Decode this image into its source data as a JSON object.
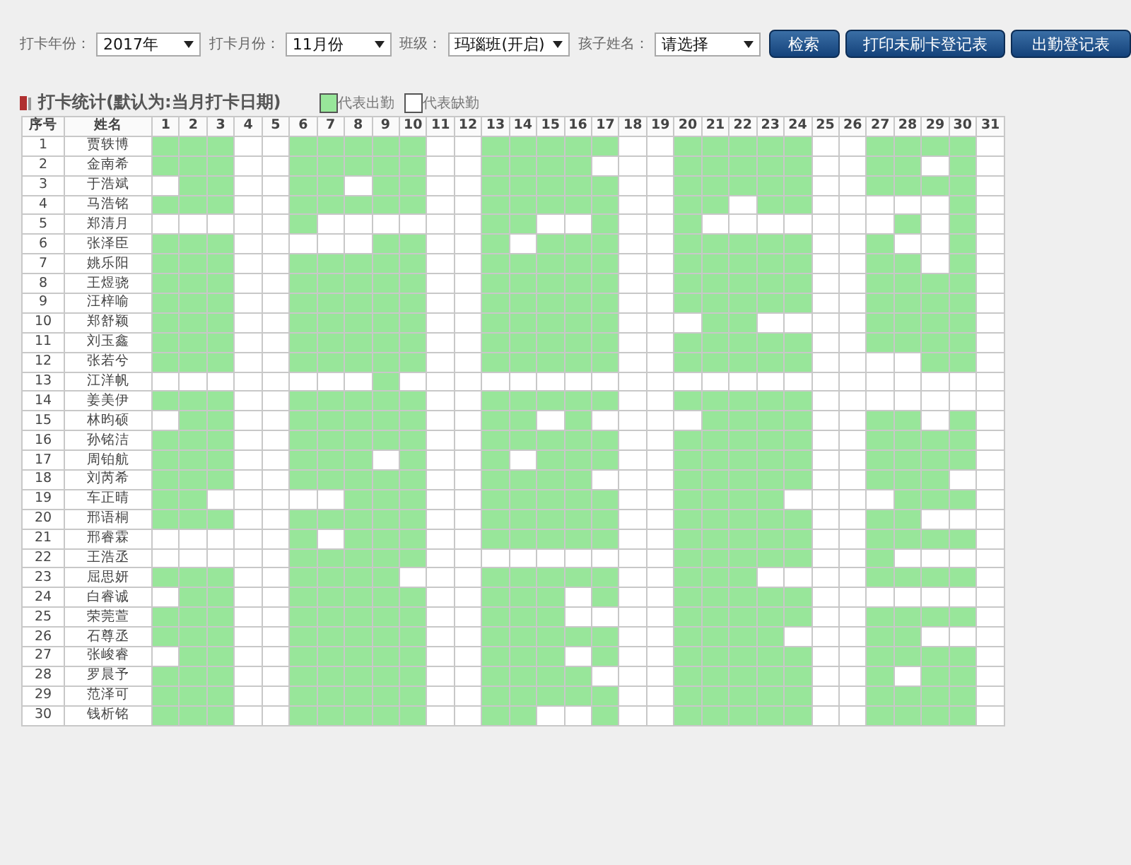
{
  "filters": [
    {
      "label": "打卡年份：",
      "value": "2017年"
    },
    {
      "label": "打卡月份：",
      "value": "11月份"
    },
    {
      "label": "班级：",
      "value": "玛瑙班(开启)"
    },
    {
      "label": "孩子姓名：",
      "value": "请选择"
    }
  ],
  "buttons": [
    "检索",
    "打印未刷卡登记表",
    "出勤登记表"
  ],
  "section_title": "打卡统计(默认为:当月打卡日期)",
  "legend": [
    {
      "label": "代表出勤",
      "color": "#98e69a"
    },
    {
      "label": "代表缺勤",
      "color": "#ffffff"
    }
  ],
  "columns": [
    "序号",
    "姓名",
    "1",
    "2",
    "3",
    "4",
    "5",
    "6",
    "7",
    "8",
    "9",
    "10",
    "11",
    "12",
    "13",
    "14",
    "15",
    "16",
    "17",
    "18",
    "19",
    "20",
    "21",
    "22",
    "23",
    "24",
    "25",
    "26",
    "27",
    "28",
    "29",
    "30",
    "31"
  ],
  "rows": [
    {
      "no": "1",
      "name": "贾轶博",
      "present": [
        true,
        true,
        true,
        false,
        false,
        true,
        true,
        true,
        true,
        true,
        false,
        false,
        true,
        true,
        true,
        true,
        true,
        false,
        false,
        true,
        true,
        true,
        true,
        true,
        false,
        false,
        true,
        true,
        true,
        true,
        false
      ]
    },
    {
      "no": "2",
      "name": "金南希",
      "present": [
        true,
        true,
        true,
        false,
        false,
        true,
        true,
        true,
        true,
        true,
        false,
        false,
        true,
        true,
        true,
        true,
        false,
        false,
        false,
        true,
        true,
        true,
        true,
        true,
        false,
        false,
        true,
        true,
        false,
        true,
        false
      ]
    },
    {
      "no": "3",
      "name": "于浩斌",
      "present": [
        false,
        true,
        true,
        false,
        false,
        true,
        true,
        false,
        true,
        true,
        false,
        false,
        true,
        true,
        true,
        true,
        true,
        false,
        false,
        true,
        true,
        true,
        true,
        true,
        false,
        false,
        true,
        true,
        true,
        true,
        false
      ]
    },
    {
      "no": "4",
      "name": "马浩铭",
      "present": [
        true,
        true,
        true,
        false,
        false,
        true,
        true,
        true,
        true,
        true,
        false,
        false,
        true,
        true,
        true,
        true,
        true,
        false,
        false,
        true,
        true,
        false,
        true,
        true,
        false,
        false,
        false,
        false,
        false,
        true,
        false
      ]
    },
    {
      "no": "5",
      "name": "郑清月",
      "present": [
        false,
        false,
        false,
        false,
        false,
        true,
        false,
        false,
        false,
        false,
        false,
        false,
        true,
        true,
        false,
        false,
        true,
        false,
        false,
        true,
        false,
        false,
        false,
        false,
        false,
        false,
        false,
        true,
        false,
        true,
        false
      ]
    },
    {
      "no": "6",
      "name": "张泽臣",
      "present": [
        true,
        true,
        true,
        false,
        false,
        false,
        false,
        false,
        true,
        true,
        false,
        false,
        true,
        false,
        true,
        true,
        true,
        false,
        false,
        true,
        true,
        true,
        true,
        true,
        false,
        false,
        true,
        false,
        false,
        true,
        false
      ]
    },
    {
      "no": "7",
      "name": "姚乐阳",
      "present": [
        true,
        true,
        true,
        false,
        false,
        true,
        true,
        true,
        true,
        true,
        false,
        false,
        true,
        true,
        true,
        true,
        true,
        false,
        false,
        true,
        true,
        true,
        true,
        true,
        false,
        false,
        true,
        true,
        false,
        true,
        false
      ]
    },
    {
      "no": "8",
      "name": "王煜骁",
      "present": [
        true,
        true,
        true,
        false,
        false,
        true,
        true,
        true,
        true,
        true,
        false,
        false,
        true,
        true,
        true,
        true,
        true,
        false,
        false,
        true,
        true,
        true,
        true,
        true,
        false,
        false,
        true,
        true,
        true,
        true,
        false
      ]
    },
    {
      "no": "9",
      "name": "汪梓喻",
      "present": [
        true,
        true,
        true,
        false,
        false,
        true,
        true,
        true,
        true,
        true,
        false,
        false,
        true,
        true,
        true,
        true,
        true,
        false,
        false,
        true,
        true,
        true,
        true,
        true,
        false,
        false,
        true,
        true,
        true,
        true,
        false
      ]
    },
    {
      "no": "10",
      "name": "郑舒颖",
      "present": [
        true,
        true,
        true,
        false,
        false,
        true,
        true,
        true,
        true,
        true,
        false,
        false,
        true,
        true,
        true,
        true,
        true,
        false,
        false,
        false,
        true,
        true,
        false,
        false,
        false,
        false,
        true,
        true,
        true,
        true,
        false
      ]
    },
    {
      "no": "11",
      "name": "刘玉鑫",
      "present": [
        true,
        true,
        true,
        false,
        false,
        true,
        true,
        true,
        true,
        true,
        false,
        false,
        true,
        true,
        true,
        true,
        true,
        false,
        false,
        true,
        true,
        true,
        true,
        true,
        false,
        false,
        true,
        true,
        true,
        true,
        false
      ]
    },
    {
      "no": "12",
      "name": "张若兮",
      "present": [
        true,
        true,
        true,
        false,
        false,
        true,
        true,
        true,
        true,
        true,
        false,
        false,
        true,
        true,
        true,
        true,
        true,
        false,
        false,
        true,
        true,
        true,
        true,
        true,
        false,
        false,
        false,
        false,
        true,
        true,
        false
      ]
    },
    {
      "no": "13",
      "name": "江洋帆",
      "present": [
        false,
        false,
        false,
        false,
        false,
        false,
        false,
        false,
        true,
        false,
        false,
        false,
        false,
        false,
        false,
        false,
        false,
        false,
        false,
        false,
        false,
        false,
        false,
        false,
        false,
        false,
        false,
        false,
        false,
        false,
        false
      ]
    },
    {
      "no": "14",
      "name": "姜美伊",
      "present": [
        true,
        true,
        true,
        false,
        false,
        true,
        true,
        true,
        true,
        true,
        false,
        false,
        true,
        true,
        true,
        true,
        true,
        false,
        false,
        true,
        true,
        true,
        true,
        true,
        false,
        false,
        false,
        false,
        false,
        false,
        false
      ]
    },
    {
      "no": "15",
      "name": "林昀硕",
      "present": [
        false,
        true,
        true,
        false,
        false,
        true,
        true,
        true,
        true,
        true,
        false,
        false,
        true,
        true,
        false,
        true,
        false,
        false,
        false,
        false,
        true,
        true,
        true,
        true,
        false,
        false,
        true,
        true,
        false,
        true,
        false
      ]
    },
    {
      "no": "16",
      "name": "孙铭洁",
      "present": [
        true,
        true,
        true,
        false,
        false,
        true,
        true,
        true,
        true,
        true,
        false,
        false,
        true,
        true,
        true,
        true,
        true,
        false,
        false,
        true,
        true,
        true,
        true,
        true,
        false,
        false,
        true,
        true,
        true,
        true,
        false
      ]
    },
    {
      "no": "17",
      "name": "周铂航",
      "present": [
        true,
        true,
        true,
        false,
        false,
        true,
        true,
        true,
        false,
        true,
        false,
        false,
        true,
        false,
        true,
        true,
        true,
        false,
        false,
        true,
        true,
        true,
        true,
        true,
        false,
        false,
        true,
        true,
        true,
        true,
        false
      ]
    },
    {
      "no": "18",
      "name": "刘芮希",
      "present": [
        true,
        true,
        true,
        false,
        false,
        true,
        true,
        true,
        true,
        true,
        false,
        false,
        true,
        true,
        true,
        true,
        false,
        false,
        false,
        true,
        true,
        true,
        true,
        true,
        false,
        false,
        true,
        true,
        true,
        false,
        false
      ]
    },
    {
      "no": "19",
      "name": "车正晴",
      "present": [
        true,
        true,
        false,
        false,
        false,
        false,
        false,
        true,
        true,
        true,
        false,
        false,
        true,
        true,
        true,
        true,
        true,
        false,
        false,
        true,
        true,
        true,
        true,
        false,
        false,
        false,
        false,
        true,
        true,
        true,
        false
      ]
    },
    {
      "no": "20",
      "name": "邢语桐",
      "present": [
        true,
        true,
        true,
        false,
        false,
        true,
        true,
        true,
        true,
        true,
        false,
        false,
        true,
        true,
        true,
        true,
        true,
        false,
        false,
        true,
        true,
        true,
        true,
        true,
        false,
        false,
        true,
        true,
        false,
        false,
        false
      ]
    },
    {
      "no": "21",
      "name": "邢睿霖",
      "present": [
        false,
        false,
        false,
        false,
        false,
        true,
        false,
        true,
        true,
        true,
        false,
        false,
        true,
        true,
        true,
        true,
        true,
        false,
        false,
        true,
        true,
        true,
        true,
        true,
        false,
        false,
        true,
        true,
        true,
        true,
        false
      ]
    },
    {
      "no": "22",
      "name": "王浩丞",
      "present": [
        false,
        false,
        false,
        false,
        false,
        true,
        true,
        true,
        true,
        true,
        false,
        false,
        false,
        false,
        false,
        false,
        false,
        false,
        false,
        true,
        true,
        true,
        true,
        true,
        false,
        false,
        true,
        false,
        false,
        false,
        false
      ]
    },
    {
      "no": "23",
      "name": "屈思妍",
      "present": [
        true,
        true,
        true,
        false,
        false,
        true,
        true,
        true,
        true,
        false,
        false,
        false,
        true,
        true,
        true,
        true,
        true,
        false,
        false,
        true,
        true,
        true,
        false,
        false,
        false,
        false,
        true,
        true,
        true,
        true,
        false
      ]
    },
    {
      "no": "24",
      "name": "白睿诚",
      "present": [
        false,
        true,
        true,
        false,
        false,
        true,
        true,
        true,
        true,
        true,
        false,
        false,
        true,
        true,
        true,
        false,
        true,
        false,
        false,
        true,
        true,
        true,
        true,
        true,
        false,
        false,
        false,
        false,
        false,
        false,
        false
      ]
    },
    {
      "no": "25",
      "name": "荣莞萱",
      "present": [
        true,
        true,
        true,
        false,
        false,
        true,
        true,
        true,
        true,
        true,
        false,
        false,
        true,
        true,
        true,
        false,
        false,
        false,
        false,
        true,
        true,
        true,
        true,
        true,
        false,
        false,
        true,
        true,
        true,
        true,
        false
      ]
    },
    {
      "no": "26",
      "name": "石尊丞",
      "present": [
        true,
        true,
        true,
        false,
        false,
        true,
        true,
        true,
        true,
        true,
        false,
        false,
        true,
        true,
        true,
        true,
        true,
        false,
        false,
        true,
        true,
        true,
        true,
        false,
        false,
        false,
        true,
        true,
        false,
        false,
        false
      ]
    },
    {
      "no": "27",
      "name": "张峻睿",
      "present": [
        false,
        true,
        true,
        false,
        false,
        true,
        true,
        true,
        true,
        true,
        false,
        false,
        true,
        true,
        true,
        false,
        true,
        false,
        false,
        true,
        true,
        true,
        true,
        true,
        false,
        false,
        true,
        true,
        true,
        true,
        false
      ]
    },
    {
      "no": "28",
      "name": "罗晨予",
      "present": [
        true,
        true,
        true,
        false,
        false,
        true,
        true,
        true,
        true,
        true,
        false,
        false,
        true,
        true,
        true,
        true,
        false,
        false,
        false,
        true,
        true,
        true,
        true,
        true,
        false,
        false,
        true,
        false,
        true,
        true,
        false
      ]
    },
    {
      "no": "29",
      "name": "范泽可",
      "present": [
        true,
        true,
        true,
        false,
        false,
        true,
        true,
        true,
        true,
        true,
        false,
        false,
        true,
        true,
        true,
        true,
        true,
        false,
        false,
        true,
        true,
        true,
        true,
        true,
        false,
        false,
        true,
        true,
        true,
        true,
        false
      ]
    },
    {
      "no": "30",
      "name": "钱析铭",
      "present": [
        true,
        true,
        true,
        false,
        false,
        true,
        true,
        true,
        true,
        true,
        false,
        false,
        true,
        true,
        false,
        false,
        true,
        false,
        false,
        true,
        true,
        true,
        true,
        true,
        false,
        false,
        true,
        true,
        true,
        true,
        false
      ]
    }
  ]
}
